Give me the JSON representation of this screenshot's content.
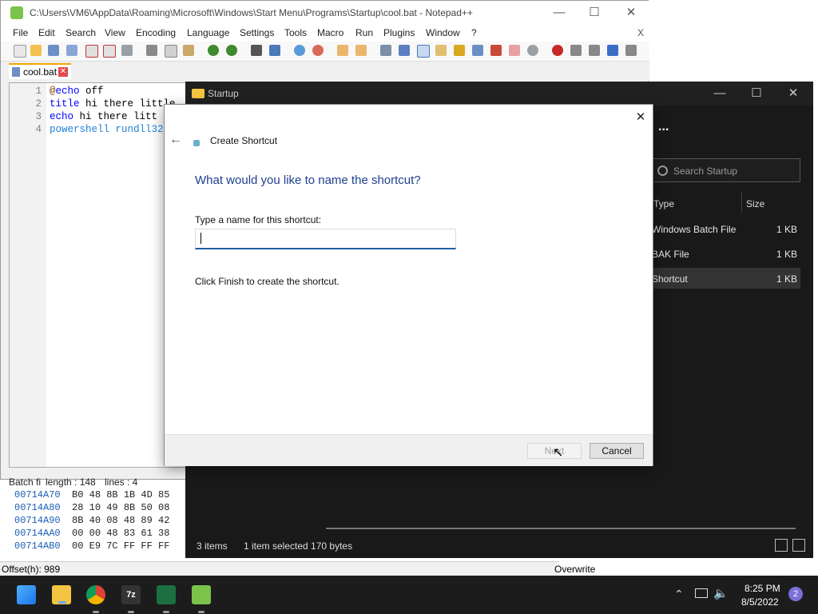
{
  "notepad": {
    "title": "C:\\Users\\VM6\\AppData\\Roaming\\Microsoft\\Windows\\Start Menu\\Programs\\Startup\\cool.bat - Notepad++",
    "menu": [
      "File",
      "Edit",
      "Search",
      "View",
      "Encoding",
      "Language",
      "Settings",
      "Tools",
      "Macro",
      "Run",
      "Plugins",
      "Window",
      "?"
    ],
    "menu_close": "X",
    "tab_label": "cool.bat",
    "lines": [
      {
        "num": "1",
        "parts": [
          [
            "@",
            "#804000"
          ],
          [
            "echo",
            "#0000ff"
          ],
          [
            " off",
            "#000000"
          ]
        ]
      },
      {
        "num": "2",
        "parts": [
          [
            "title",
            "#0000ff"
          ],
          [
            " hi there little",
            "#000000"
          ]
        ]
      },
      {
        "num": "3",
        "parts": [
          [
            "echo",
            "#0000ff"
          ],
          [
            " hi there litt",
            "#000000"
          ]
        ]
      },
      {
        "num": "4",
        "parts": [
          [
            "powershell rundll32",
            "#1f7fd8"
          ]
        ]
      }
    ],
    "status_type": "Batch fi",
    "status_length": "length : 148",
    "status_lines": "lines : 4"
  },
  "hex": {
    "rows": [
      {
        "addr": "00714A70",
        "bytes": "B0 48 8B 1B 4D 85"
      },
      {
        "addr": "00714A80",
        "bytes": "28 10 49 8B 50 08"
      },
      {
        "addr": "00714A90",
        "bytes": "8B 40 08 48 89 42"
      },
      {
        "addr": "00714AA0",
        "bytes": "00 00 48 83 61 38"
      },
      {
        "addr": "00714AB0",
        "bytes": "00 E9 7C FF FF FF"
      }
    ],
    "offset": "Offset(h): 989",
    "mode": "Overwrite"
  },
  "explorer": {
    "title": "Startup",
    "search_placeholder": "Search Startup",
    "more": "...",
    "col_type": "Type",
    "col_size": "Size",
    "rows": [
      {
        "type": "Windows Batch File",
        "size": "1 KB"
      },
      {
        "type": "BAK File",
        "size": "1 KB"
      },
      {
        "type": "Shortcut",
        "size": "1 KB"
      }
    ],
    "status_items": "3 items",
    "status_selected": "1 item selected  170 bytes"
  },
  "dialog": {
    "header": "Create Shortcut",
    "question": "What would you like to name the shortcut?",
    "field_label": "Type a name for this shortcut:",
    "field_value": "",
    "hint": "Click Finish to create the shortcut.",
    "next_label": "Next",
    "cancel_label": "Cancel"
  },
  "taskbar": {
    "time": "8:25 PM",
    "date": "8/5/2022",
    "notification_count": "2",
    "apps": [
      "start-button",
      "file-explorer",
      "chrome",
      "7zip",
      "excel",
      "notepadpp"
    ]
  },
  "colors": {
    "accent": "#1f5fa8",
    "dialog_title": "#1f3f8f",
    "explorer_bg": "#191919",
    "taskbar_bg": "#1c1c1c"
  }
}
